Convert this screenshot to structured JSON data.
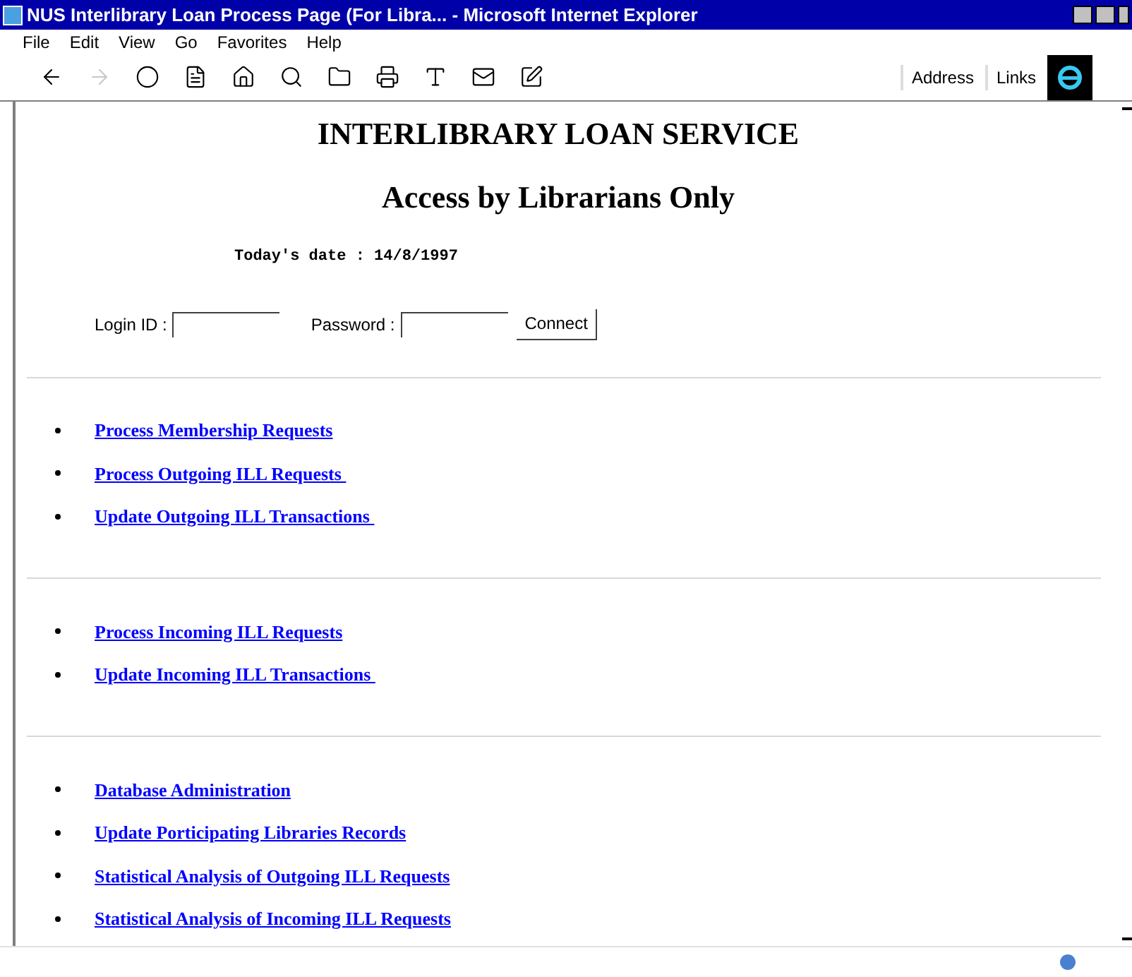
{
  "window": {
    "title": "NUS Interlibrary Loan Process Page (For Libra... - Microsoft Internet Explorer"
  },
  "menu": [
    "File",
    "Edit",
    "View",
    "Go",
    "Favorites",
    "Help"
  ],
  "toolbar": {
    "address_label": "Address",
    "links_label": "Links"
  },
  "page": {
    "heading": "INTERLIBRARY LOAN SERVICE",
    "subheading": "Access by Librarians Only",
    "date": "Today's date : 14/8/1997",
    "login": {
      "login_label": "Login ID :",
      "password_label": "Password :",
      "button": "Connect"
    },
    "sections": [
      {
        "links": [
          "Process Membership Requests",
          "Process Outgoing ILL Requests ",
          "Update Outgoing ILL Transactions "
        ]
      },
      {
        "links": [
          "Process Incoming ILL Requests",
          "Update Incoming ILL Transactions "
        ]
      },
      {
        "links": [
          "Database Administration",
          "Update Porticipating Libraries Records",
          "Statistical Analysis of Outgoing ILL Requests",
          "Statistical Analysis of Incoming ILL Requests"
        ]
      }
    ]
  }
}
